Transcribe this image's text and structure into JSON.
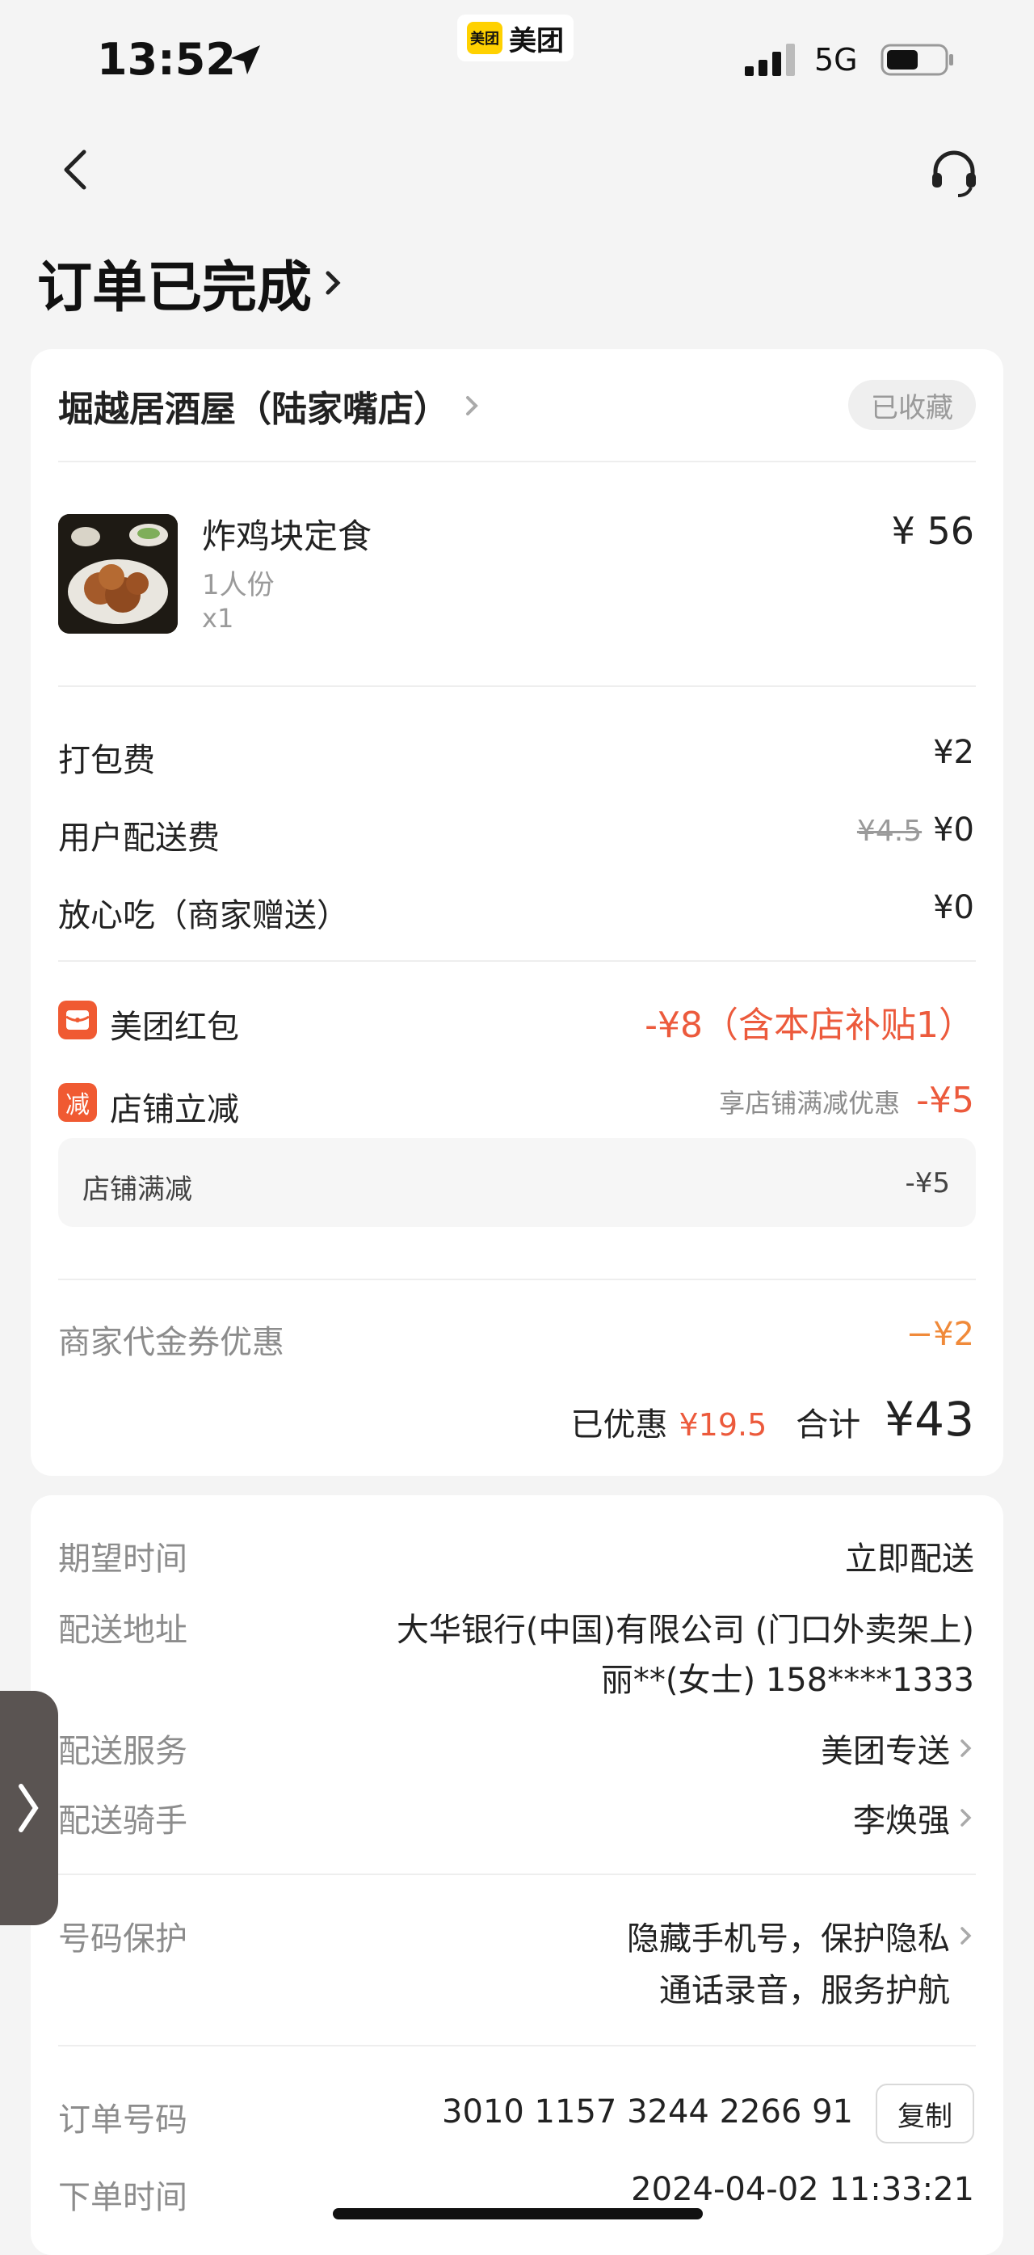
{
  "status_bar": {
    "time": "13:52",
    "app_name": "美团",
    "app_logo_text": "美团",
    "network": "5G"
  },
  "header": {
    "title": "订单已完成"
  },
  "shop": {
    "name": "堀越居酒屋（陆家嘴店）",
    "fav_label": "已收藏"
  },
  "item": {
    "name": "炸鸡块定食",
    "spec": "1人份",
    "qty": "x1",
    "price": "¥ 56"
  },
  "fees": {
    "packing_label": "打包费",
    "packing_value": "¥2",
    "delivery_label": "用户配送费",
    "delivery_original": "¥4.5",
    "delivery_value": "¥0",
    "assurance_label": "放心吃（商家赠送）",
    "assurance_value": "¥0"
  },
  "discounts": {
    "redpacket_icon_label": "",
    "redpacket_label": "美团红包",
    "redpacket_value": "-¥8（含本店补贴1）",
    "instant_icon_label": "减",
    "instant_label": "店铺立减",
    "instant_note": "享店铺满减优惠",
    "instant_value": "-¥5",
    "sub_label": "店铺满减",
    "sub_value": "-¥5",
    "voucher_label": "商家代金券优惠",
    "voucher_value": "−¥2"
  },
  "totals": {
    "saved_label": "已优惠",
    "saved_value": "¥19.5",
    "total_label": "合计",
    "total_value": "¥43"
  },
  "delivery": {
    "expect_label": "期望时间",
    "expect_value": "立即配送",
    "address_label": "配送地址",
    "address_line1": "大华银行(中国)有限公司 (门口外卖架上)",
    "address_line2": "丽**(女士) 158****1333",
    "service_label": "配送服务",
    "service_value": "美团专送",
    "rider_label": "配送骑手",
    "rider_value": "李焕强",
    "privacy_label": "号码保护",
    "privacy_line1": "隐藏手机号，保护隐私",
    "privacy_line2": "通话录音，服务护航"
  },
  "order": {
    "number_label": "订单号码",
    "number_value": "3010 1157 3244 2266 91",
    "copy_label": "复制",
    "time_label": "下单时间",
    "time_value": "2024-04-02 11:33:21"
  }
}
